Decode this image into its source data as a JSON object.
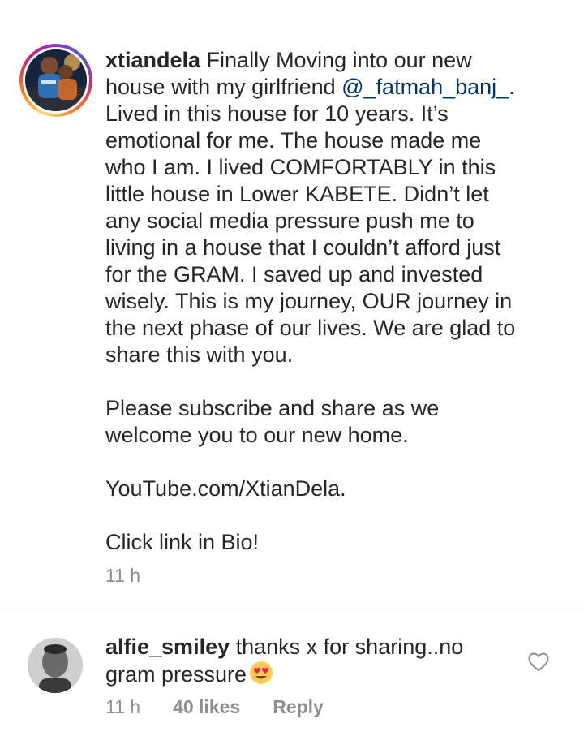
{
  "post": {
    "username": "xtiandela",
    "caption_before": " Finally Moving into our new\nhouse with my girlfriend ",
    "mention": "@_fatmah_banj_",
    "caption_after": ".\nLived in this house for 10 years. It’s\nemotional for me. The house made me\nwho I am. I lived COMFORTABLY in this\nlittle house in Lower KABETE. Didn’t let\nany social media pressure push me to\nliving in a house that I couldn’t afford just\nfor the GRAM. I saved up and invested\nwisely. This is my journey, OUR journey in\nthe next phase of our lives. We are glad to\nshare this with you.\n\nPlease subscribe  and share as we\nwelcome you to our new home.\n\nYouTube.com/XtianDela.\n\nClick link in Bio!",
    "time": "11 h"
  },
  "comment": {
    "username": "alfie_smiley",
    "text": " thanks x for sharing..no\ngram pressure",
    "emoji": "heart-eyes-emoji",
    "time": "11 h",
    "likes": "40 likes",
    "reply_label": "Reply",
    "like_icon": "heart-outline-icon"
  },
  "colors": {
    "text": "#262626",
    "muted": "#8e8e8e",
    "mention": "#003569",
    "divider": "#dbdbdb"
  }
}
